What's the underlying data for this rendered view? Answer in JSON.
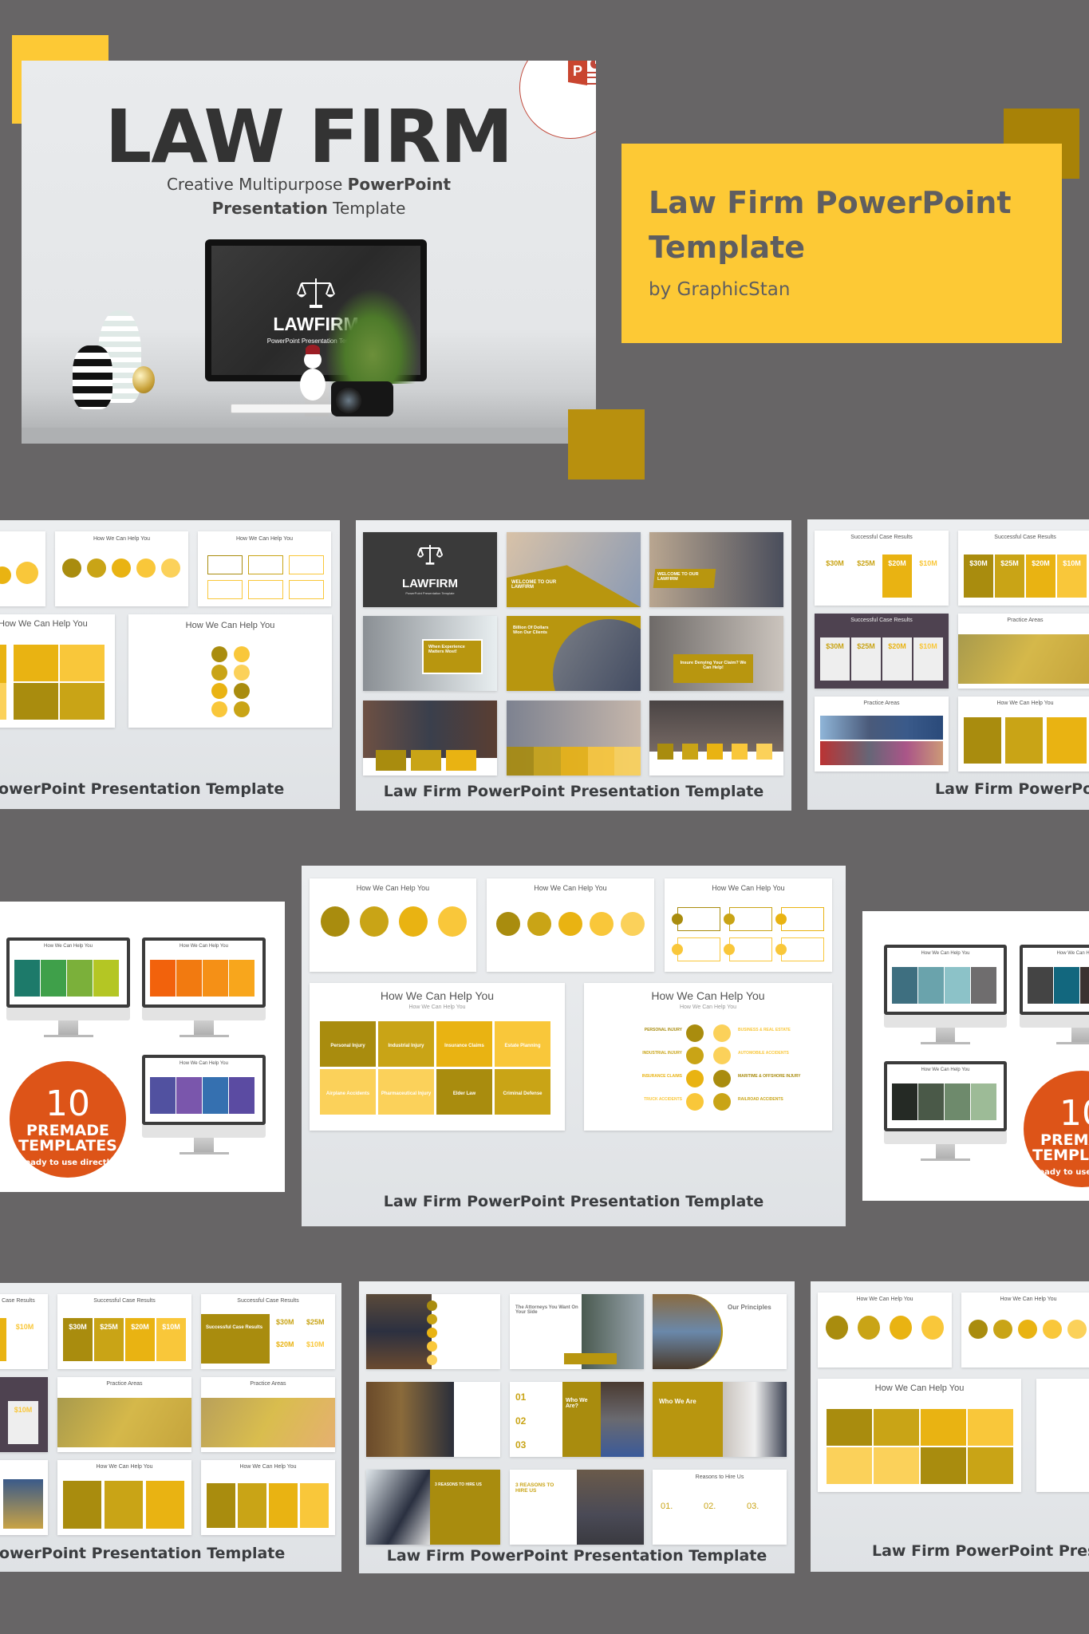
{
  "hero": {
    "title": "LAW FIRM",
    "subtitle_line1_normal": "Creative Multipurpose ",
    "subtitle_line1_bold": "PowerPoint",
    "subtitle_line2_bold": "Presentation",
    "subtitle_line2_normal": " Template",
    "monitor_logo": "LAWFIRM",
    "monitor_tagline": "PowerPoint Presentation Template",
    "badge_icon": "powerpoint-icon"
  },
  "title_box": {
    "heading_line1": "Law Firm PowerPoint",
    "heading_line2": "Template",
    "byline": "by GraphicStan"
  },
  "colors": {
    "background": "#676566",
    "accent_yellow": "#FDC935",
    "accent_gold": "#B8900E",
    "dark_gold": "#A98C0E",
    "premade_orange": "#DD5418"
  },
  "caption": "Law Firm PowerPoint Presentation Template",
  "slides": {
    "how_we_help": "How We Can Help You",
    "case_results": "Successful Case Results",
    "practice_areas": "Practice Areas",
    "our_principles": "Our Principles",
    "reasons_to_hire": "Reasons to Hire Us",
    "who_we_are": "Who We Are",
    "who_we_are_q": "Who We Are?",
    "attorneys": "The Attorneys You Want On Your Side",
    "three_reasons": "3 REASONS TO HIRE US",
    "welcome": "WELCOME TO OUR LAWFIRM",
    "billion": "Billion Of Dollars Won Our Clients",
    "experience": "When Experience Matters Most!",
    "insure": "Insure Denying Your Claim? We Can Help!",
    "lawfirm_logo": "LAWFIRM",
    "lawfirm_tag": "PowerPoint Presentation Template",
    "amounts": [
      "$30M",
      "$25M",
      "$20M",
      "$10M"
    ],
    "numbers": [
      "01",
      "02",
      "03"
    ],
    "reasons_numbers": [
      "01.",
      "02.",
      "03."
    ],
    "grid_services": [
      "Personal Injury",
      "Industrial Injury",
      "Insurance Claims",
      "Estate Planning",
      "Airplane Accidents",
      "Pharmaceutical Injury",
      "Elder Law",
      "Criminal Defense"
    ],
    "left_services": [
      "PERSONAL INJURY",
      "INDUSTRIAL INJURY",
      "INSURANCE CLAIMS",
      "TRUCK ACCIDENTS"
    ],
    "right_services": [
      "BUSINESS & REAL ESTATE",
      "AUTOMOBILE ACCIDENTS",
      "MARITIME & OFFSHORE INJURY",
      "RAILROAD ACCIDENTS"
    ]
  },
  "premade": {
    "count": "10",
    "line1": "PREMADE",
    "line2": "TEMPLATES",
    "line3": "ready to use directly"
  }
}
